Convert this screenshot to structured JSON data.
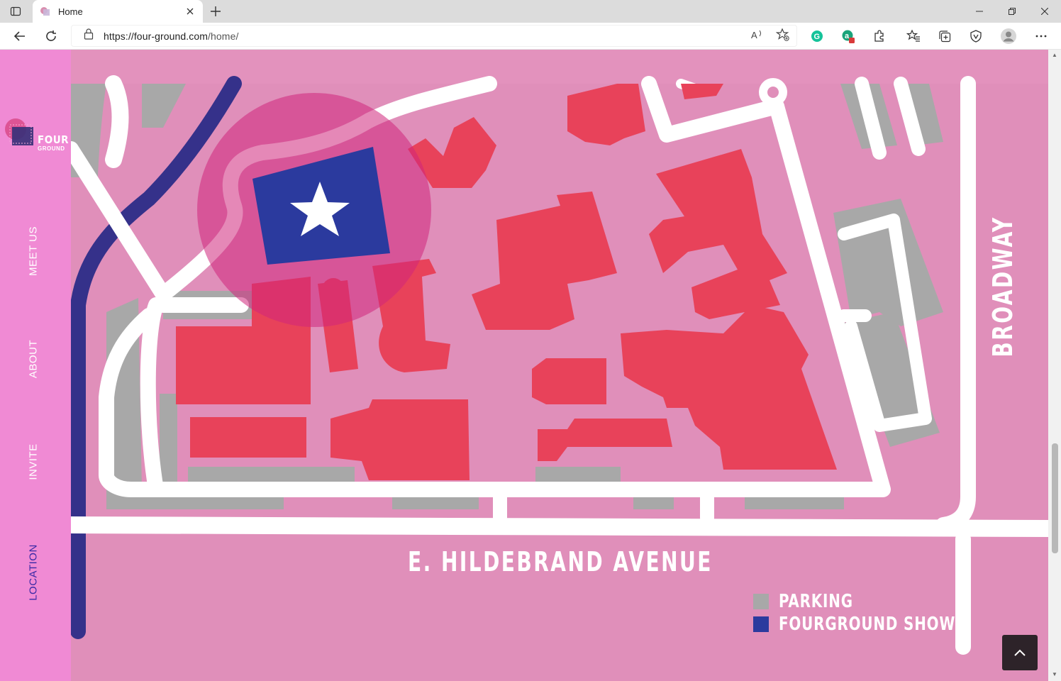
{
  "browser": {
    "tab_title": "Home",
    "url_host": "https://four-ground.com",
    "url_path": "/home/",
    "icons": [
      "tab-actions-icon",
      "close-icon",
      "plus-icon",
      "minimize-icon",
      "restore-icon",
      "back-icon",
      "reload-icon",
      "lock-icon",
      "read-aloud-icon",
      "favorite-add-icon",
      "grammarly-icon",
      "extension-icon",
      "puzzle-icon",
      "favorites-icon",
      "collections-icon",
      "browser-essentials-icon",
      "profile-icon",
      "more-icon"
    ]
  },
  "sidebar": {
    "logo_text_top": "FOUR",
    "logo_text_bottom": "GROUND",
    "nav": [
      {
        "label": "MEET US"
      },
      {
        "label": "ABOUT"
      },
      {
        "label": "INVITE"
      },
      {
        "label": "LOCATION"
      }
    ]
  },
  "map": {
    "street_bottom": "E. HILDEBRAND AVENUE",
    "street_right": "BROADWAY",
    "legend": [
      {
        "label": "PARKING",
        "color": "#a8a8a8"
      },
      {
        "label": "FOURGROUND SHOW",
        "color": "#2b3a9e"
      }
    ]
  },
  "colors": {
    "page_bg": "#e093be",
    "sidebar_bg": "#f08ad4",
    "building": "#e8425a",
    "road": "#ffffff",
    "parking": "#a8a8a8",
    "river": "#35318a",
    "highlight": "#2b3a9e"
  }
}
